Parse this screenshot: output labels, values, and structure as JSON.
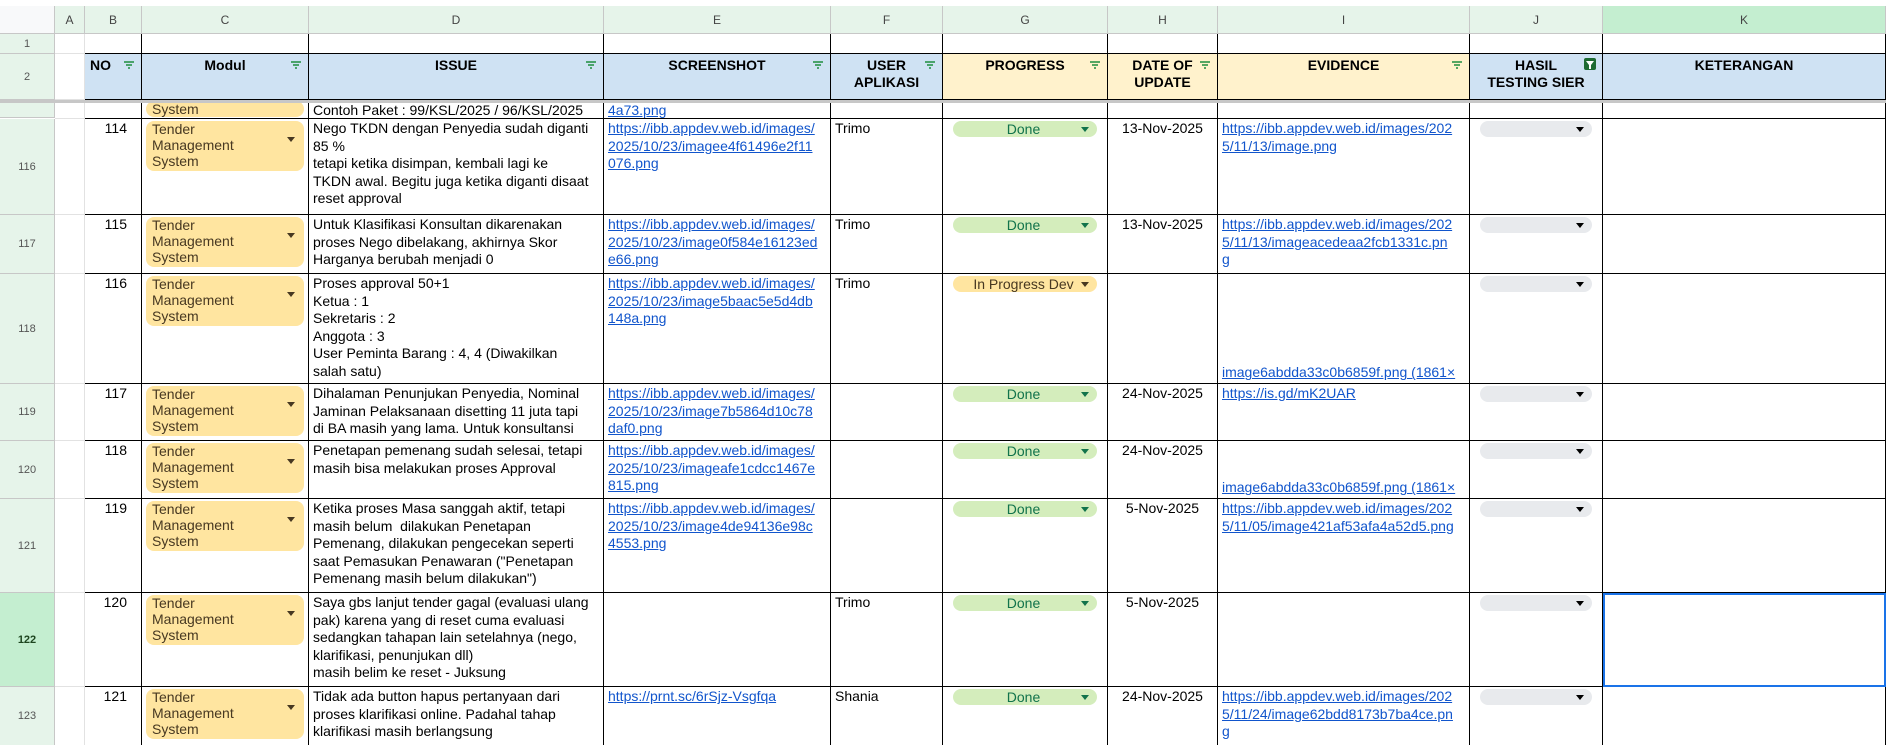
{
  "columns": [
    "A",
    "B",
    "C",
    "D",
    "E",
    "F",
    "G",
    "H",
    "I",
    "J",
    "K"
  ],
  "row_numbers_header": [
    "1",
    "2"
  ],
  "headers": {
    "no": "NO",
    "modul": "Modul",
    "issue": "ISSUE",
    "screenshot": "SCREENSHOT",
    "user": "USER\nAPLIKASI",
    "progress": "PROGRESS",
    "date": "DATE OF\nUPDATE",
    "evidence": "EVIDENCE",
    "hasil": "HASIL\nTESTING SIER",
    "keterangan": "KETERANGAN"
  },
  "partial_row": {
    "modul": "System",
    "issue": "Contoh Paket : 99/KSL/2025 / 96/KSL/2025",
    "screenshot": "4a73.png"
  },
  "rows": [
    {
      "row": "116",
      "no": "114",
      "modul": "Tender\nManagement\nSystem",
      "issue": "Nego TKDN dengan Penyedia sudah diganti\n85 %\ntetapi ketika disimpan, kembali lagi ke\nTKDN awal. Begitu juga ketika diganti disaat\nreset approval",
      "screenshot": "https://ibb.appdev.web.id/images/\n2025/10/23/imagee4f61496e2f11\n076.png",
      "user": "Trimo",
      "progress": "Done",
      "date": "13-Nov-2025",
      "evidence": "https://ibb.appdev.web.id/images/202\n5/11/13/image.png",
      "evidence_bottom": false,
      "hasil": "",
      "keterangan": ""
    },
    {
      "row": "117",
      "no": "115",
      "modul": "Tender\nManagement\nSystem",
      "issue": "Untuk Klasifikasi Konsultan dikarenakan\nproses Nego dibelakang, akhirnya Skor\nHarganya berubah menjadi 0",
      "screenshot": "https://ibb.appdev.web.id/images/\n2025/10/23/image0f584e16123ed\ne66.png",
      "user": "Trimo",
      "progress": "Done",
      "date": "13-Nov-2025",
      "evidence": "https://ibb.appdev.web.id/images/202\n5/11/13/imageacedeaa2fcb1331c.pn\ng",
      "evidence_bottom": false,
      "hasil": "",
      "keterangan": ""
    },
    {
      "row": "118",
      "no": "116",
      "modul": "Tender\nManagement\nSystem",
      "issue": "Proses approval 50+1\nKetua : 1\nSekretaris : 2\nAnggota : 3\nUser Peminta Barang : 4, 4 (Diwakilkan\nsalah satu)",
      "screenshot": "https://ibb.appdev.web.id/images/\n2025/10/23/image5baac5e5d4db\n148a.png",
      "user": "Trimo",
      "progress": "In Progress Dev",
      "date": "",
      "evidence": "image6abdda33c0b6859f.png (1861×",
      "evidence_bottom": true,
      "hasil": "",
      "keterangan": ""
    },
    {
      "row": "119",
      "no": "117",
      "modul": "Tender\nManagement\nSystem",
      "issue": "Dihalaman Penunjukan Penyedia, Nominal\nJaminan Pelaksanaan disetting 11 juta tapi\ndi BA masih yang lama. Untuk konsultansi",
      "screenshot": "https://ibb.appdev.web.id/images/\n2025/10/23/image7b5864d10c78\ndaf0.png",
      "user": "",
      "progress": "Done",
      "date": "24-Nov-2025",
      "evidence": "https://is.gd/mK2UAR",
      "evidence_bottom": false,
      "hasil": "",
      "keterangan": ""
    },
    {
      "row": "120",
      "no": "118",
      "modul": "Tender\nManagement\nSystem",
      "issue": "Penetapan pemenang sudah selesai, tetapi\nmasih bisa melakukan proses Approval",
      "screenshot": "https://ibb.appdev.web.id/images/\n2025/10/23/imageafe1cdcc1467e\n815.png",
      "user": "",
      "progress": "Done",
      "date": "24-Nov-2025",
      "evidence": "image6abdda33c0b6859f.png (1861×",
      "evidence_bottom": true,
      "hasil": "",
      "keterangan": ""
    },
    {
      "row": "121",
      "no": "119",
      "modul": "Tender\nManagement\nSystem",
      "issue": "Ketika proses Masa sanggah aktif, tetapi\nmasih belum  dilakukan Penetapan\nPemenang, dilakukan pengecekan seperti\nsaat Pemasukan Penawaran (\"Penetapan\nPemenang masih belum dilakukan\")",
      "screenshot": "https://ibb.appdev.web.id/images/\n2025/10/23/image4de94136e98c\n4553.png",
      "user": "",
      "progress": "Done",
      "date": "5-Nov-2025",
      "evidence": "https://ibb.appdev.web.id/images/202\n5/11/05/image421af53afa4a52d5.png",
      "evidence_bottom": false,
      "hasil": "",
      "keterangan": ""
    },
    {
      "row": "122",
      "no": "120",
      "modul": "Tender\nManagement\nSystem",
      "issue": "Saya gbs lanjut tender gagal (evaluasi ulang\npak) karena yang di reset cuma evaluasi\nsedangkan tahapan lain setelahnya (nego,\nklarifikasi, penunjukan dll)\nmasih belim ke reset - Juksung",
      "screenshot": "",
      "user": "Trimo",
      "progress": "Done",
      "date": "5-Nov-2025",
      "evidence": "",
      "evidence_bottom": false,
      "hasil": "",
      "keterangan": "",
      "selected": true
    },
    {
      "row": "123",
      "no": "121",
      "modul": "Tender\nManagement\nSystem",
      "issue": "Tidak ada button hapus pertanyaan dari\nproses klarifikasi online. Padahal tahap\nklarifikasi masih berlangsung",
      "screenshot": "https://prnt.sc/6rSjz-Vsgfqa",
      "user": "Shania",
      "progress": "Done",
      "date": "24-Nov-2025",
      "evidence": "https://ibb.appdev.web.id/images/202\n5/11/24/image62bdd8173b7ba4ce.pn\ng",
      "evidence_bottom": false,
      "hasil": "",
      "keterangan": ""
    }
  ],
  "colors": {
    "done_bg": "#d4edbc",
    "progress_bg": "#ffe5a0",
    "link": "#1155cc",
    "selection": "#1a73e8"
  }
}
